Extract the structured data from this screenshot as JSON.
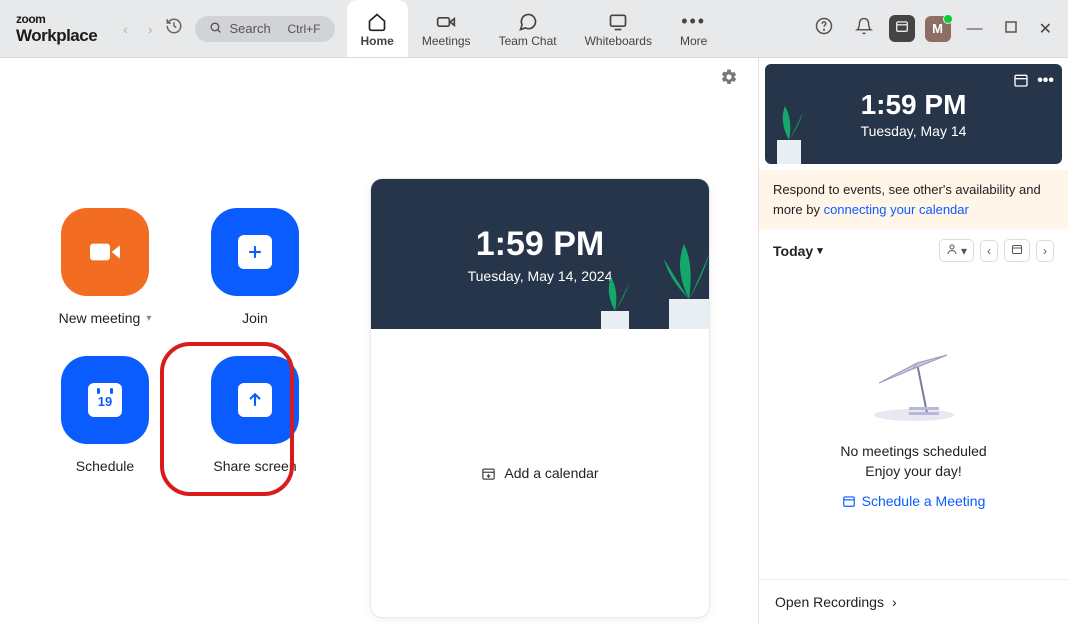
{
  "app": {
    "logo_top": "zoom",
    "logo_bottom": "Workplace"
  },
  "search": {
    "placeholder": "Search",
    "shortcut": "Ctrl+F"
  },
  "tabs": {
    "home": "Home",
    "meetings": "Meetings",
    "team_chat": "Team Chat",
    "whiteboards": "Whiteboards",
    "more": "More"
  },
  "avatar_initial": "M",
  "actions": {
    "new_meeting": "New meeting",
    "join": "Join",
    "schedule": "Schedule",
    "schedule_day": "19",
    "share_screen": "Share screen"
  },
  "card": {
    "time": "1:59 PM",
    "date": "Tuesday, May 14, 2024",
    "add_calendar": "Add a calendar"
  },
  "sidebar": {
    "time": "1:59 PM",
    "date": "Tuesday, May 14",
    "notice_prefix": "Respond to events, see other's availability and more by ",
    "notice_link": "connecting your calendar",
    "today": "Today",
    "empty_line1": "No meetings scheduled",
    "empty_line2": "Enjoy your day!",
    "schedule_link": "Schedule a Meeting",
    "open_recordings": "Open Recordings"
  }
}
